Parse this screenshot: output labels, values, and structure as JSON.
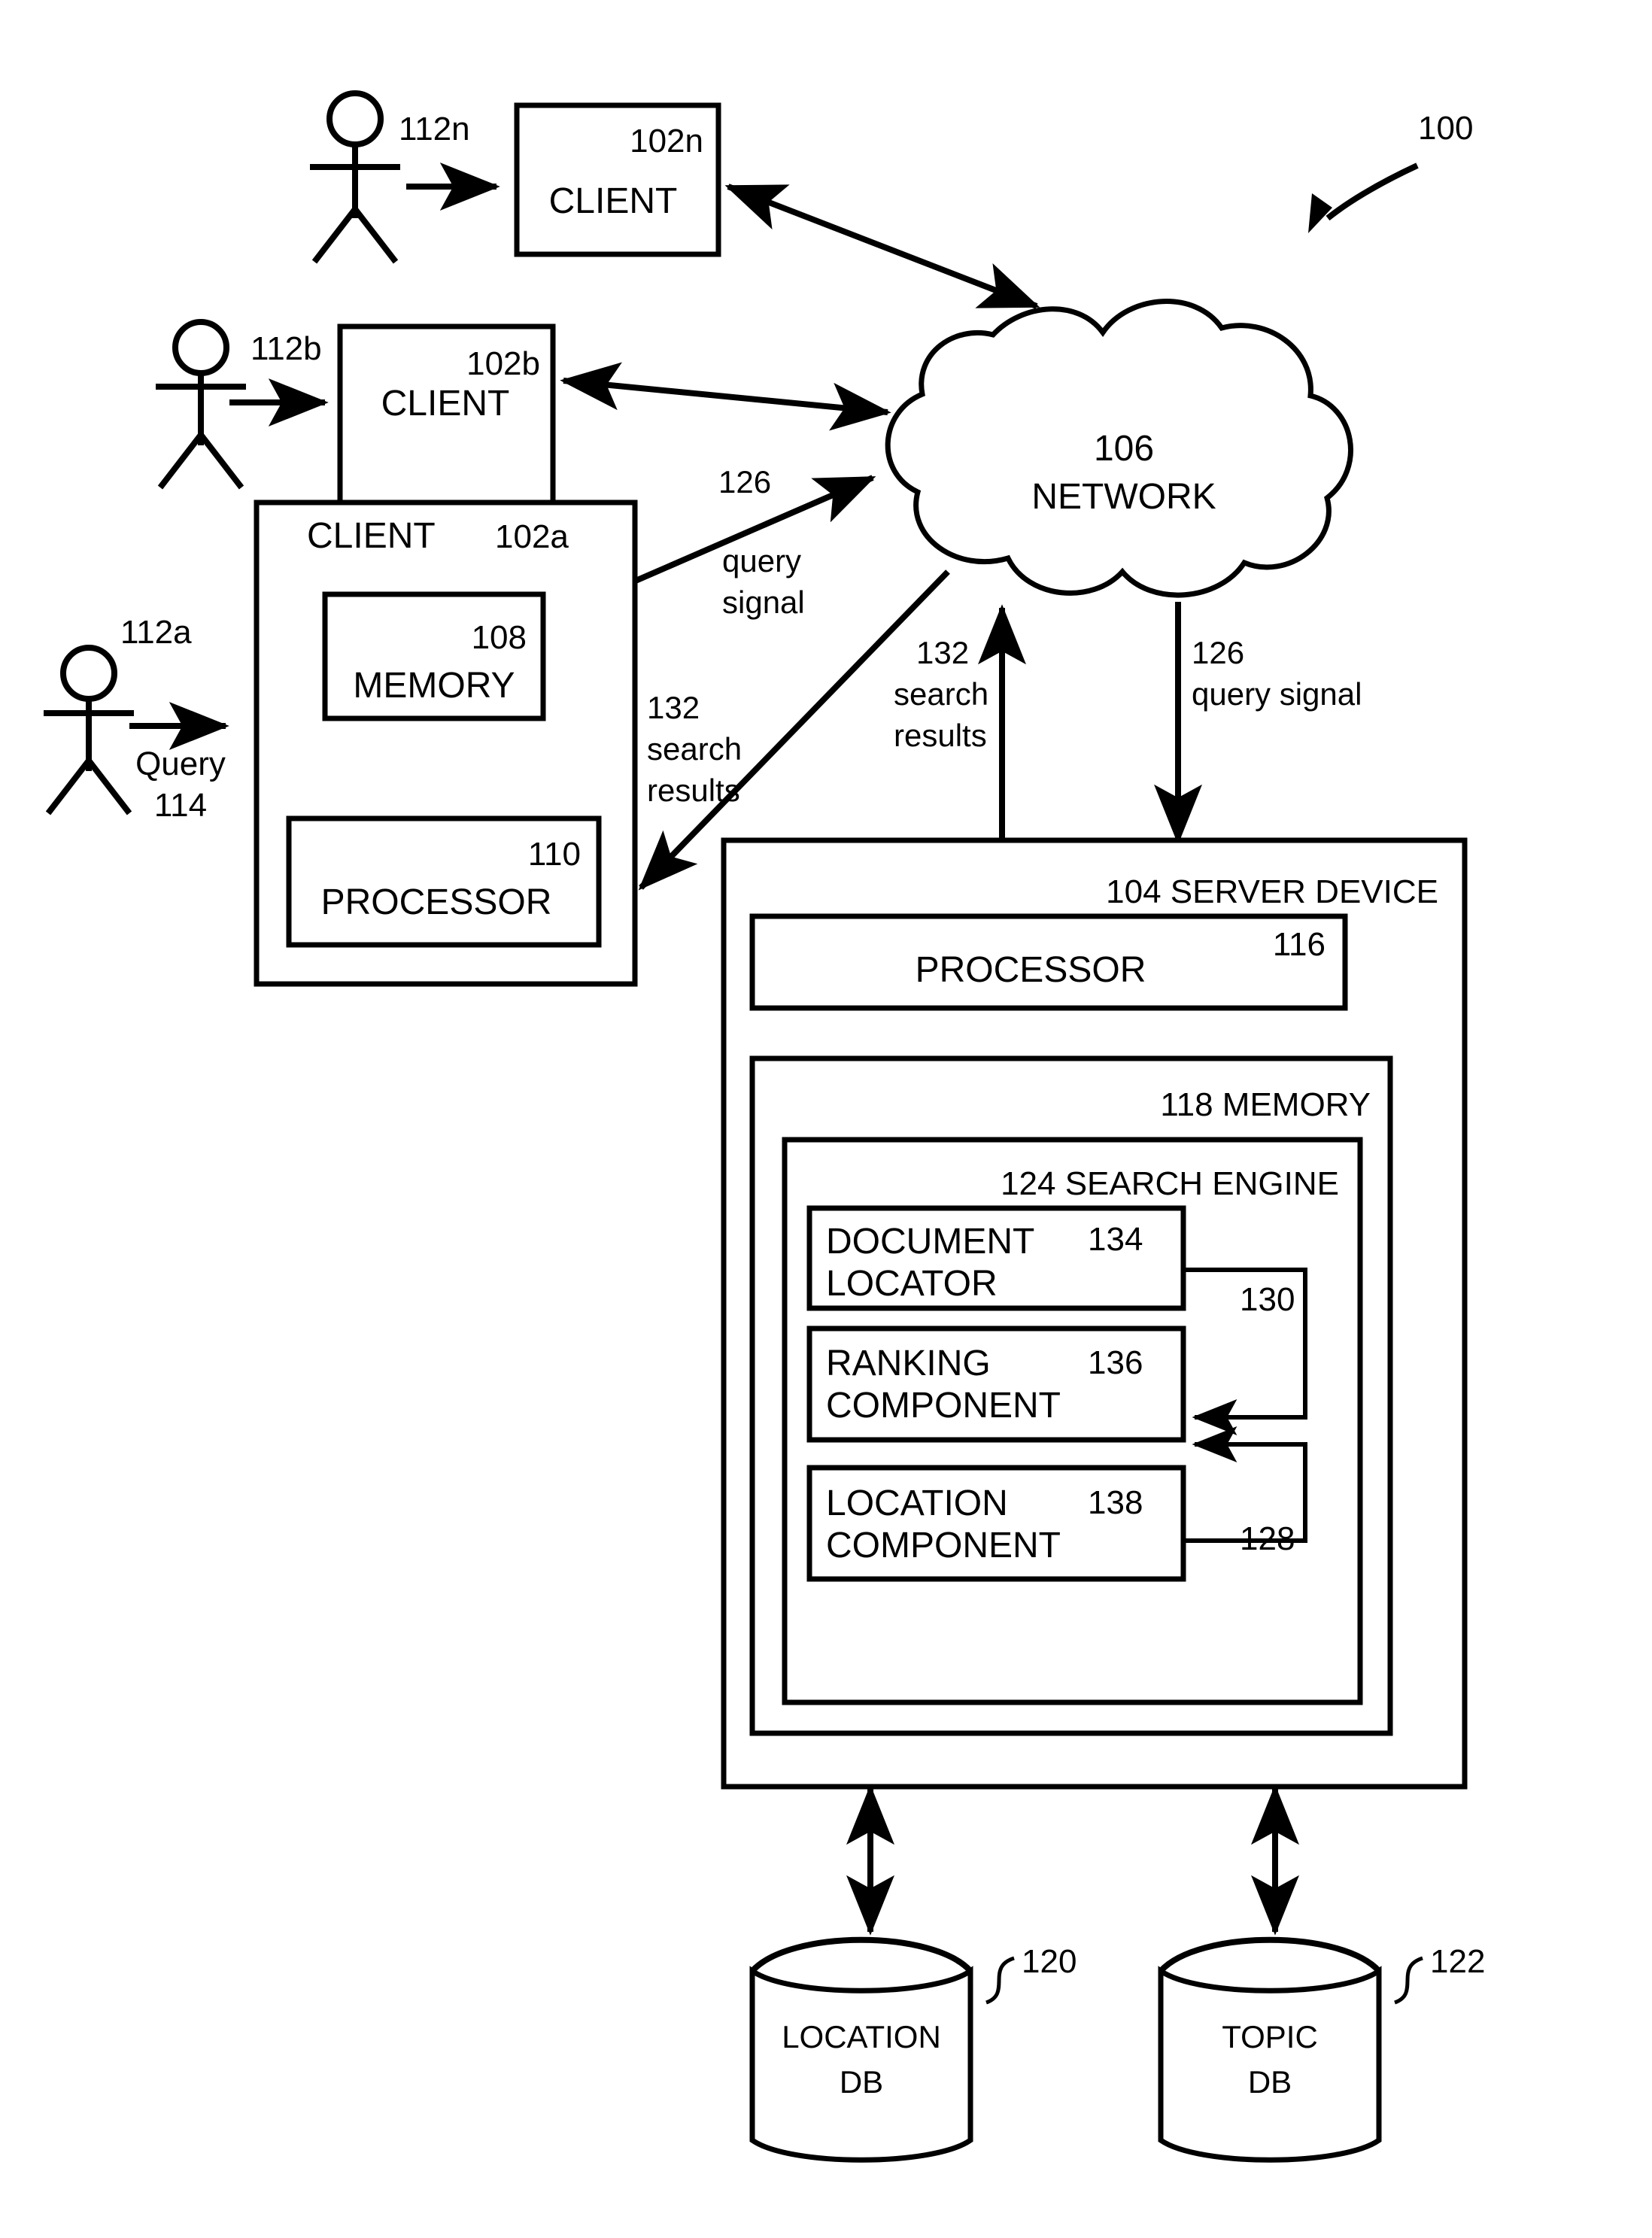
{
  "figure": {
    "id": "fig-1",
    "system_ref": "100",
    "domain": "patent-system-diagram"
  },
  "actors": [
    {
      "id": "actor-112n",
      "ref": "112n",
      "name": "user-112n"
    },
    {
      "id": "actor-112b",
      "ref": "112b",
      "name": "user-112b"
    },
    {
      "id": "actor-112a",
      "ref": "112a",
      "name": "user-112a",
      "action_line1": "Query",
      "action_line2": "114"
    }
  ],
  "clients": [
    {
      "id": "client-102n",
      "label": "CLIENT",
      "ref": "102n"
    },
    {
      "id": "client-102b",
      "label": "CLIENT",
      "ref": "102b"
    },
    {
      "id": "client-102a",
      "label": "CLIENT",
      "ref": "102a",
      "memory": {
        "label": "MEMORY",
        "ref": "108"
      },
      "processor": {
        "label": "PROCESSOR",
        "ref": "110"
      }
    }
  ],
  "network": {
    "ref": "106",
    "label": "NETWORK"
  },
  "server": {
    "header": "104 SERVER DEVICE",
    "ref": "104",
    "label": "SERVER DEVICE",
    "processor": {
      "label": "PROCESSOR",
      "ref": "116"
    },
    "memory": {
      "header": "118 MEMORY",
      "ref": "118",
      "label": "MEMORY"
    },
    "search_engine": {
      "header": "124 SEARCH ENGINE",
      "ref": "124",
      "label": "SEARCH ENGINE",
      "components": [
        {
          "id": "comp-134",
          "line1": "DOCUMENT",
          "line2": "LOCATOR",
          "ref": "134"
        },
        {
          "id": "comp-136",
          "line1": "RANKING",
          "line2": "COMPONENT",
          "ref": "136"
        },
        {
          "id": "comp-138",
          "line1": "LOCATION",
          "line2": "COMPONENT",
          "ref": "138"
        }
      ],
      "connectors": [
        {
          "id": "conn-130",
          "ref": "130",
          "from": "comp-134",
          "to": "comp-136"
        },
        {
          "id": "conn-128",
          "ref": "128",
          "from": "comp-138",
          "to": "comp-136"
        }
      ]
    }
  },
  "databases": [
    {
      "id": "db-120",
      "line1": "LOCATION",
      "line2": "DB",
      "ref": "120"
    },
    {
      "id": "db-122",
      "line1": "TOPIC",
      "line2": "DB",
      "ref": "122"
    }
  ],
  "flow_labels": {
    "client_a_to_network": {
      "ref": "126",
      "line1": "query",
      "line2": "signal"
    },
    "network_to_client_a": {
      "ref": "132",
      "line1": "search",
      "line2": "results"
    },
    "server_to_network": {
      "ref": "132",
      "line1": "search",
      "line2": "results"
    },
    "network_to_server": {
      "ref": "126",
      "text": "query signal"
    }
  },
  "colors": {
    "ink": "#000000",
    "paper": "#ffffff"
  }
}
